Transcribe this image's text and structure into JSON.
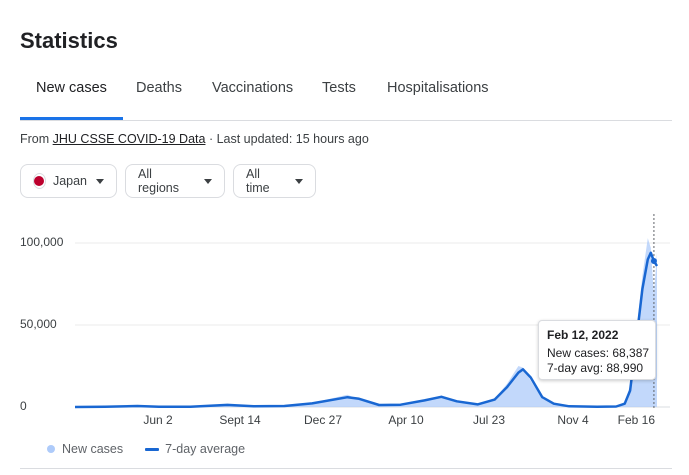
{
  "page_title": "Statistics",
  "tabs": [
    {
      "label": "New cases",
      "active": true
    },
    {
      "label": "Deaths",
      "active": false
    },
    {
      "label": "Vaccinations",
      "active": false
    },
    {
      "label": "Tests",
      "active": false
    },
    {
      "label": "Hospitalisations",
      "active": false
    }
  ],
  "source": {
    "prefix": "From ",
    "link": "JHU CSSE COVID-19 Data",
    "suffix": " · Last updated: 15 hours ago"
  },
  "filters": {
    "country": "Japan",
    "region": "All regions",
    "time": "All time"
  },
  "colors": {
    "accent": "#1a73e8",
    "line": "#1967d2",
    "area": "#aecbfa",
    "flag_red": "#bc002d"
  },
  "tooltip": {
    "date": "Feb 12, 2022",
    "new_cases": "New cases: 68,387",
    "avg": "7-day avg: 88,990"
  },
  "legend": {
    "new_cases": "New cases",
    "avg": "7-day average"
  },
  "chart_data": {
    "type": "area",
    "ylim": [
      0,
      110000
    ],
    "yticks": [
      {
        "value": 0,
        "label": "0"
      },
      {
        "value": 50000,
        "label": "50,000"
      },
      {
        "value": 100000,
        "label": "100,000"
      }
    ],
    "xticks": [
      "Jun 2",
      "Sept 14",
      "Dec 27",
      "Apr 10",
      "Jul 23",
      "Nov 4",
      "Feb 16"
    ],
    "x_range": [
      "Jan 22, 2020",
      "Feb 16, 2022"
    ],
    "grid": true,
    "series": [
      {
        "name": "7-day average",
        "points": [
          [
            "2020-01-22",
            0
          ],
          [
            "2020-03-01",
            100
          ],
          [
            "2020-04-12",
            600
          ],
          [
            "2020-05-10",
            100
          ],
          [
            "2020-06-20",
            100
          ],
          [
            "2020-08-07",
            1300
          ],
          [
            "2020-09-10",
            500
          ],
          [
            "2020-10-20",
            600
          ],
          [
            "2020-11-25",
            2200
          ],
          [
            "2021-01-10",
            6000
          ],
          [
            "2021-01-25",
            5000
          ],
          [
            "2021-02-20",
            1200
          ],
          [
            "2021-03-20",
            1400
          ],
          [
            "2021-04-20",
            4000
          ],
          [
            "2021-05-12",
            6200
          ],
          [
            "2021-06-01",
            3500
          ],
          [
            "2021-06-28",
            1600
          ],
          [
            "2021-07-20",
            4500
          ],
          [
            "2021-08-05",
            12000
          ],
          [
            "2021-08-20",
            21000
          ],
          [
            "2021-08-26",
            23000
          ],
          [
            "2021-09-05",
            18000
          ],
          [
            "2021-09-20",
            6000
          ],
          [
            "2021-10-05",
            2000
          ],
          [
            "2021-10-25",
            400
          ],
          [
            "2021-11-30",
            100
          ],
          [
            "2021-12-25",
            300
          ],
          [
            "2022-01-05",
            2000
          ],
          [
            "2022-01-12",
            10000
          ],
          [
            "2022-01-20",
            40000
          ],
          [
            "2022-01-28",
            72000
          ],
          [
            "2022-02-04",
            90000
          ],
          [
            "2022-02-08",
            94000
          ],
          [
            "2022-02-12",
            88990
          ],
          [
            "2022-02-16",
            86000
          ]
        ]
      },
      {
        "name": "New cases",
        "points": [
          [
            "2020-01-22",
            0
          ],
          [
            "2020-03-01",
            150
          ],
          [
            "2020-04-12",
            700
          ],
          [
            "2020-05-10",
            100
          ],
          [
            "2020-06-20",
            150
          ],
          [
            "2020-08-07",
            1500
          ],
          [
            "2020-09-10",
            600
          ],
          [
            "2020-10-20",
            700
          ],
          [
            "2020-11-25",
            2500
          ],
          [
            "2021-01-10",
            7500
          ],
          [
            "2021-01-25",
            4500
          ],
          [
            "2021-02-20",
            1000
          ],
          [
            "2021-03-20",
            1600
          ],
          [
            "2021-04-20",
            4500
          ],
          [
            "2021-05-12",
            7000
          ],
          [
            "2021-06-01",
            3000
          ],
          [
            "2021-06-28",
            1500
          ],
          [
            "2021-07-20",
            5000
          ],
          [
            "2021-08-05",
            14000
          ],
          [
            "2021-08-20",
            25000
          ],
          [
            "2021-08-26",
            24000
          ],
          [
            "2021-09-05",
            16000
          ],
          [
            "2021-09-20",
            5000
          ],
          [
            "2021-10-05",
            1500
          ],
          [
            "2021-10-25",
            300
          ],
          [
            "2021-11-30",
            100
          ],
          [
            "2021-12-25",
            400
          ],
          [
            "2022-01-05",
            3000
          ],
          [
            "2022-01-12",
            13000
          ],
          [
            "2022-01-20",
            45000
          ],
          [
            "2022-01-28",
            80000
          ],
          [
            "2022-02-04",
            103000
          ],
          [
            "2022-02-08",
            97000
          ],
          [
            "2022-02-12",
            68387
          ],
          [
            "2022-02-16",
            94000
          ]
        ]
      }
    ],
    "highlight": {
      "x": "2022-02-12",
      "new_cases": 68387,
      "avg": 88990
    }
  }
}
